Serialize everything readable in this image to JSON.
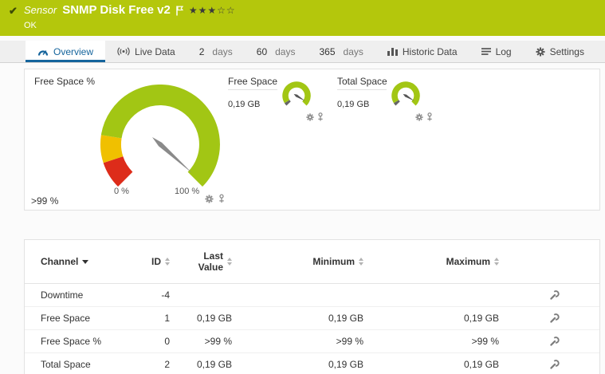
{
  "colors": {
    "header_bg": "#b4c70c",
    "accent_blue": "#15649c",
    "gauge_green": "#a2c614",
    "gauge_yellow": "#f0c000",
    "gauge_red": "#dd2c1a"
  },
  "icons": {
    "check": "✔",
    "stars": "★★★☆☆"
  },
  "header": {
    "kind": "Sensor",
    "title": "SNMP Disk Free v2",
    "status": "OK",
    "priority_filled": 3,
    "priority_total": 5
  },
  "tabs": [
    {
      "label": "Overview",
      "icon": "gauge-icon",
      "active": true
    },
    {
      "label": "Live Data",
      "icon": "live-data-icon"
    },
    {
      "number": "2",
      "unit": "days"
    },
    {
      "number": "60",
      "unit": "days"
    },
    {
      "number": "365",
      "unit": "days"
    },
    {
      "label": "Historic Data",
      "icon": "historic-data-icon"
    },
    {
      "label": "Log",
      "icon": "log-icon"
    },
    {
      "label": "Settings",
      "icon": "gear-icon"
    }
  ],
  "gauges": {
    "main": {
      "title": "Free Space %",
      "value": ">99 %",
      "scale_min": "0 %",
      "scale_max": "100 %"
    },
    "mini": [
      {
        "title": "Free Space",
        "value": "0,19 GB"
      },
      {
        "title": "Total Space",
        "value": "0,19 GB"
      }
    ]
  },
  "table": {
    "headers": {
      "channel": "Channel",
      "id": "ID",
      "last": "Last Value",
      "min": "Minimum",
      "max": "Maximum"
    },
    "rows": [
      {
        "channel": "Downtime",
        "id": "-4",
        "last": "",
        "min": "",
        "max": ""
      },
      {
        "channel": "Free Space",
        "id": "1",
        "last": "0,19 GB",
        "min": "0,19 GB",
        "max": "0,19 GB"
      },
      {
        "channel": "Free Space %",
        "id": "0",
        "last": ">99 %",
        "min": ">99 %",
        "max": ">99 %"
      },
      {
        "channel": "Total Space",
        "id": "2",
        "last": "0,19 GB",
        "min": "0,19 GB",
        "max": "0,19 GB"
      }
    ]
  }
}
